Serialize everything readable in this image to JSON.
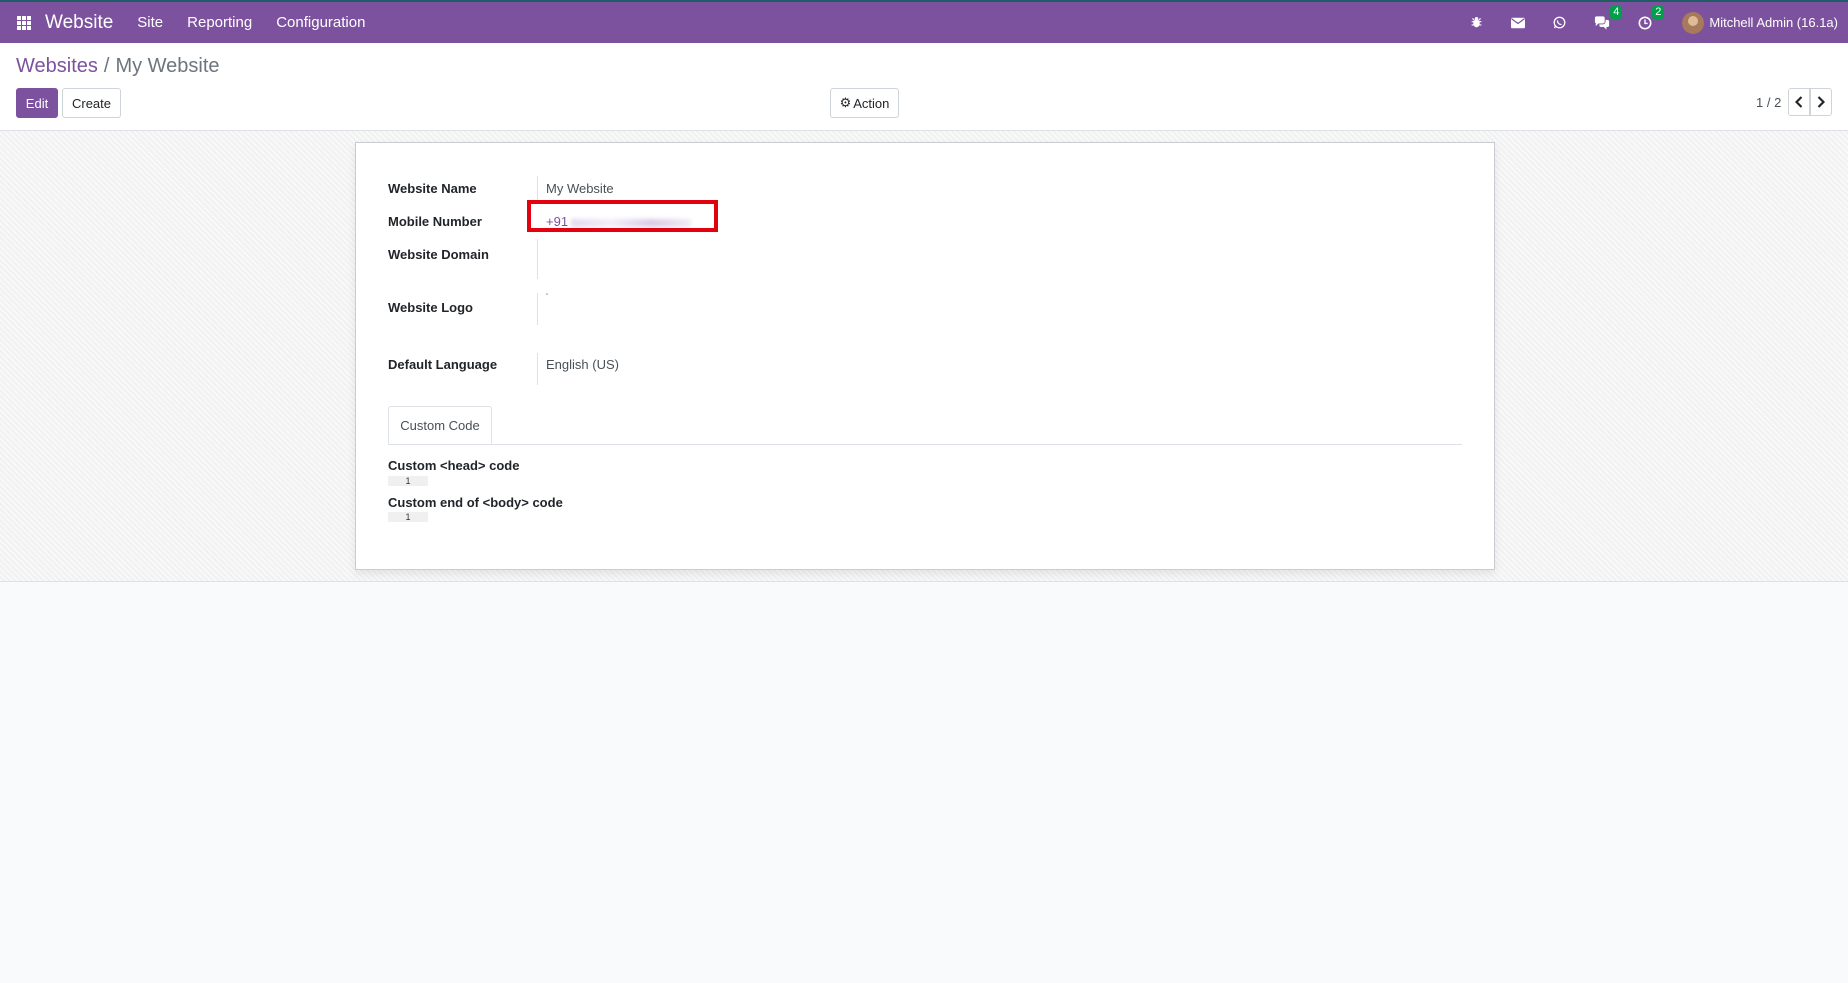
{
  "navbar": {
    "app_name": "Website",
    "menu": [
      "Site",
      "Reporting",
      "Configuration"
    ],
    "icons": [
      "bug-icon",
      "envelope-icon",
      "whatsapp-icon",
      "chat-icon",
      "activity-clock-icon"
    ],
    "messages_badge": "4",
    "activities_badge": "2",
    "user_name": "Mitchell Admin (16.1a)",
    "color": "#7c519e"
  },
  "breadcrumb": {
    "parent": "Websites",
    "separator": "/",
    "current": "My Website"
  },
  "toolbar": {
    "edit_label": "Edit",
    "create_label": "Create",
    "action_label": "Action"
  },
  "pager": {
    "value": "1 / 2"
  },
  "form": {
    "website_name": {
      "label": "Website Name",
      "value": "My Website"
    },
    "mobile_number": {
      "label": "Mobile Number",
      "value": "+91"
    },
    "website_domain": {
      "label": "Website Domain",
      "value": ""
    },
    "website_logo": {
      "label": "Website Logo"
    },
    "default_language": {
      "label": "Default Language",
      "value": "English (US)"
    },
    "tabs": [
      "Custom Code"
    ],
    "custom_head": {
      "label": "Custom <head> code",
      "line": "1"
    },
    "custom_body": {
      "label": "Custom end of <body> code",
      "line": "1"
    }
  },
  "highlight_color": "#e3000f"
}
